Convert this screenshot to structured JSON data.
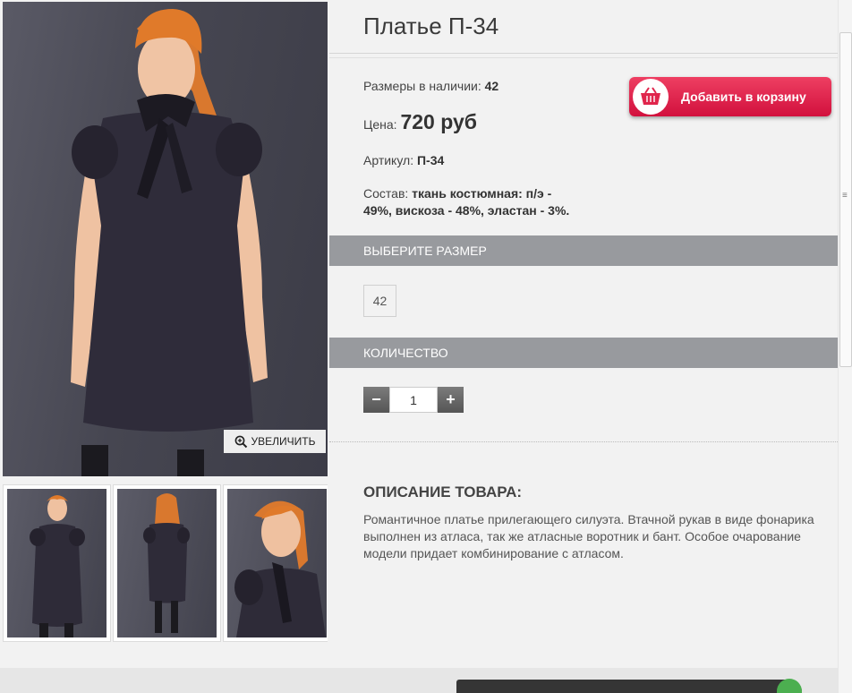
{
  "product": {
    "title": "Платье П-34",
    "sizes_label": "Размеры в наличии:",
    "sizes_value": "42",
    "price_label": "Цена:",
    "price_value": "720 руб",
    "article_label": "Артикул:",
    "article_value": "П-34",
    "composition_label": "Состав:",
    "composition_value_line1": "ткань костюмная: п/э -",
    "composition_value_line2": "49%, вискоза - 48%, эластан - 3%."
  },
  "cart_button": {
    "label": "Добавить в корзину",
    "color": "#e0254c"
  },
  "gallery": {
    "zoom_label": "УВЕЛИЧИТЬ",
    "thumbnails": [
      "front-full",
      "back-full",
      "front-closeup"
    ]
  },
  "size_section": {
    "header": "ВЫБЕРИТЕ РАЗМЕР",
    "options": [
      "42"
    ]
  },
  "quantity_section": {
    "header": "КОЛИЧЕСТВО",
    "minus": "−",
    "plus": "+",
    "value": "1"
  },
  "description": {
    "title": "ОПИСАНИЕ ТОВАРА:",
    "text": "Романтичное платье прилегающего силуэта. Втачной рукав в виде фонарика выполнен из атласа, так же атласные воротник и бант. Особое очарование модели придает комбинирование с атласом."
  },
  "colors": {
    "section_bar": "#989a9e",
    "background": "#f2f2f2"
  }
}
